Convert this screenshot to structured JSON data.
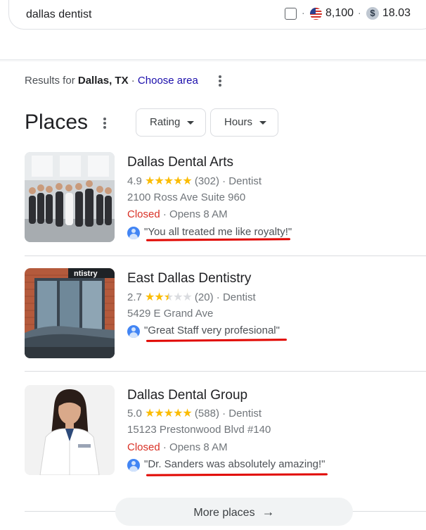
{
  "search": {
    "query": "dallas dentist",
    "separator": "·",
    "search_volume": "8,100",
    "cpc": "18.03",
    "dollar_symbol": "$"
  },
  "location": {
    "prefix": "Results for",
    "place": "Dallas, TX",
    "separator": "·",
    "choose_area": "Choose area"
  },
  "places": {
    "title": "Places",
    "filters": [
      "Rating",
      "Hours"
    ],
    "items": [
      {
        "name": "Dallas Dental Arts",
        "rating": "4.9",
        "rating_value": 4.9,
        "reviews": "(302)",
        "category": "Dentist",
        "address": "2100 Ross Ave Suite 960",
        "status": "Closed",
        "hours": "Opens 8 AM",
        "review": "\"You all treated me like royalty!\""
      },
      {
        "name": "East Dallas Dentistry",
        "rating": "2.7",
        "rating_value": 2.7,
        "reviews": "(20)",
        "category": "Dentist",
        "address": "5429 E Grand Ave",
        "status": "",
        "hours": "",
        "review": "\"Great Staff very profesional\""
      },
      {
        "name": "Dallas Dental Group",
        "rating": "5.0",
        "rating_value": 5.0,
        "reviews": "(588)",
        "category": "Dentist",
        "address": "15123 Prestonwood Blvd #140",
        "status": "Closed",
        "hours": "Opens 8 AM",
        "review": "\"Dr. Sanders was absolutely amazing!\""
      }
    ],
    "more_places": "More places",
    "more_arrow": "→",
    "separator": "·"
  },
  "colors": {
    "link": "#1a0dab",
    "star": "#fbbc04",
    "closed": "#d93025",
    "annotation_underline": "#e10600"
  }
}
